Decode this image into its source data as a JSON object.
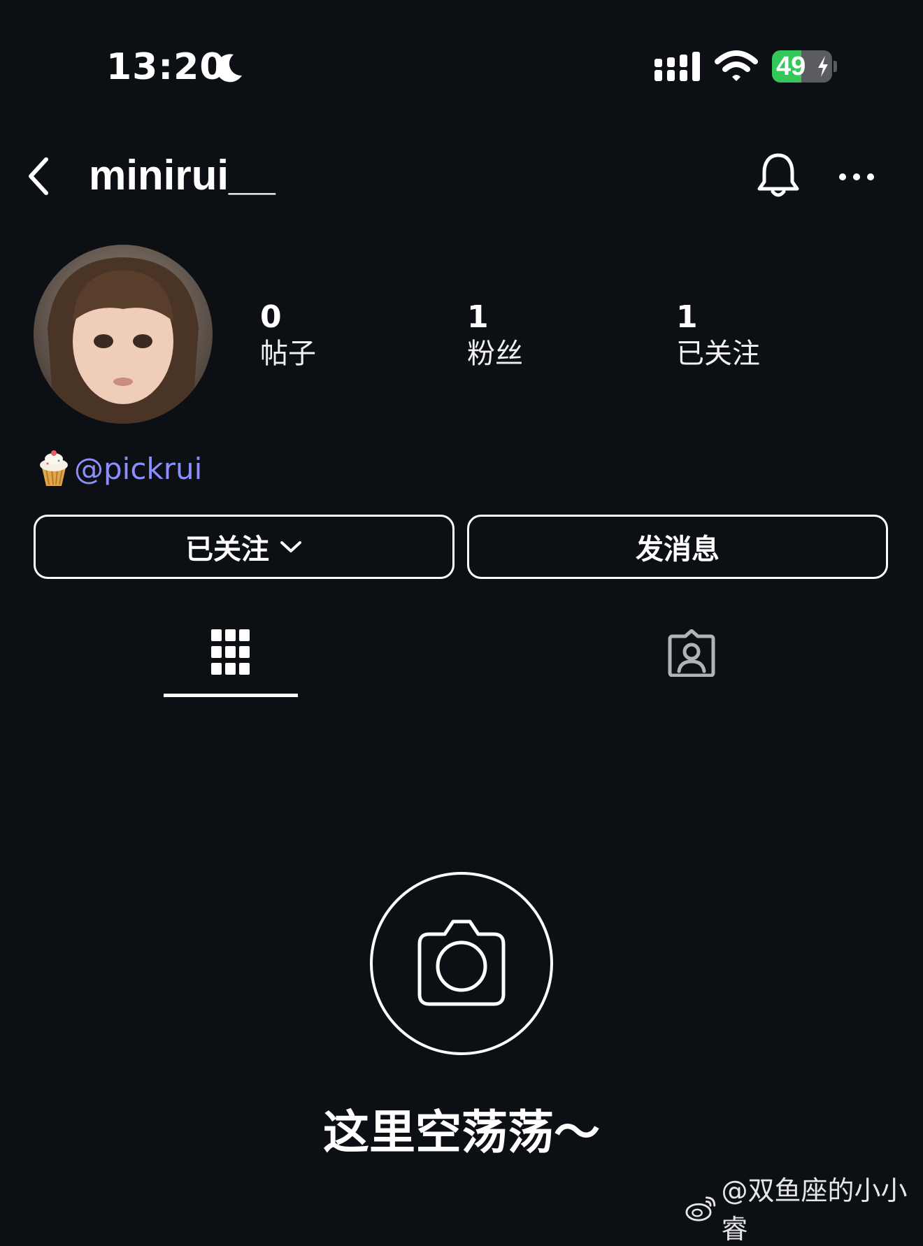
{
  "status_bar": {
    "time": "13:20",
    "battery_percent": "49",
    "battery_level": 0.49,
    "battery_color": "#34c759",
    "icons": [
      "moon-icon",
      "cellular-signal-icon",
      "wifi-icon",
      "battery-charging-icon"
    ]
  },
  "header": {
    "username": "minirui__",
    "icons": [
      "back-chevron-icon",
      "bell-icon",
      "more-icon"
    ]
  },
  "profile": {
    "avatar": "avatar",
    "stats": [
      {
        "value": "0",
        "label": "帖子"
      },
      {
        "value": "1",
        "label": "粉丝"
      },
      {
        "value": "1",
        "label": "已关注"
      }
    ],
    "handle_emoji": "cupcake-icon",
    "handle": "@pickrui",
    "handle_color": "#8a8ffb"
  },
  "actions": {
    "following_label": "已关注",
    "message_label": "发消息"
  },
  "tabs": {
    "items": [
      "grid-icon",
      "tagged-person-icon"
    ],
    "active": 0
  },
  "empty_state": {
    "icon": "camera-icon",
    "text": "这里空荡荡～"
  },
  "watermark": {
    "text": "@双鱼座的小小睿",
    "icon": "weibo-icon"
  },
  "colors": {
    "background": "#0c0f14",
    "foreground": "#ffffff"
  }
}
